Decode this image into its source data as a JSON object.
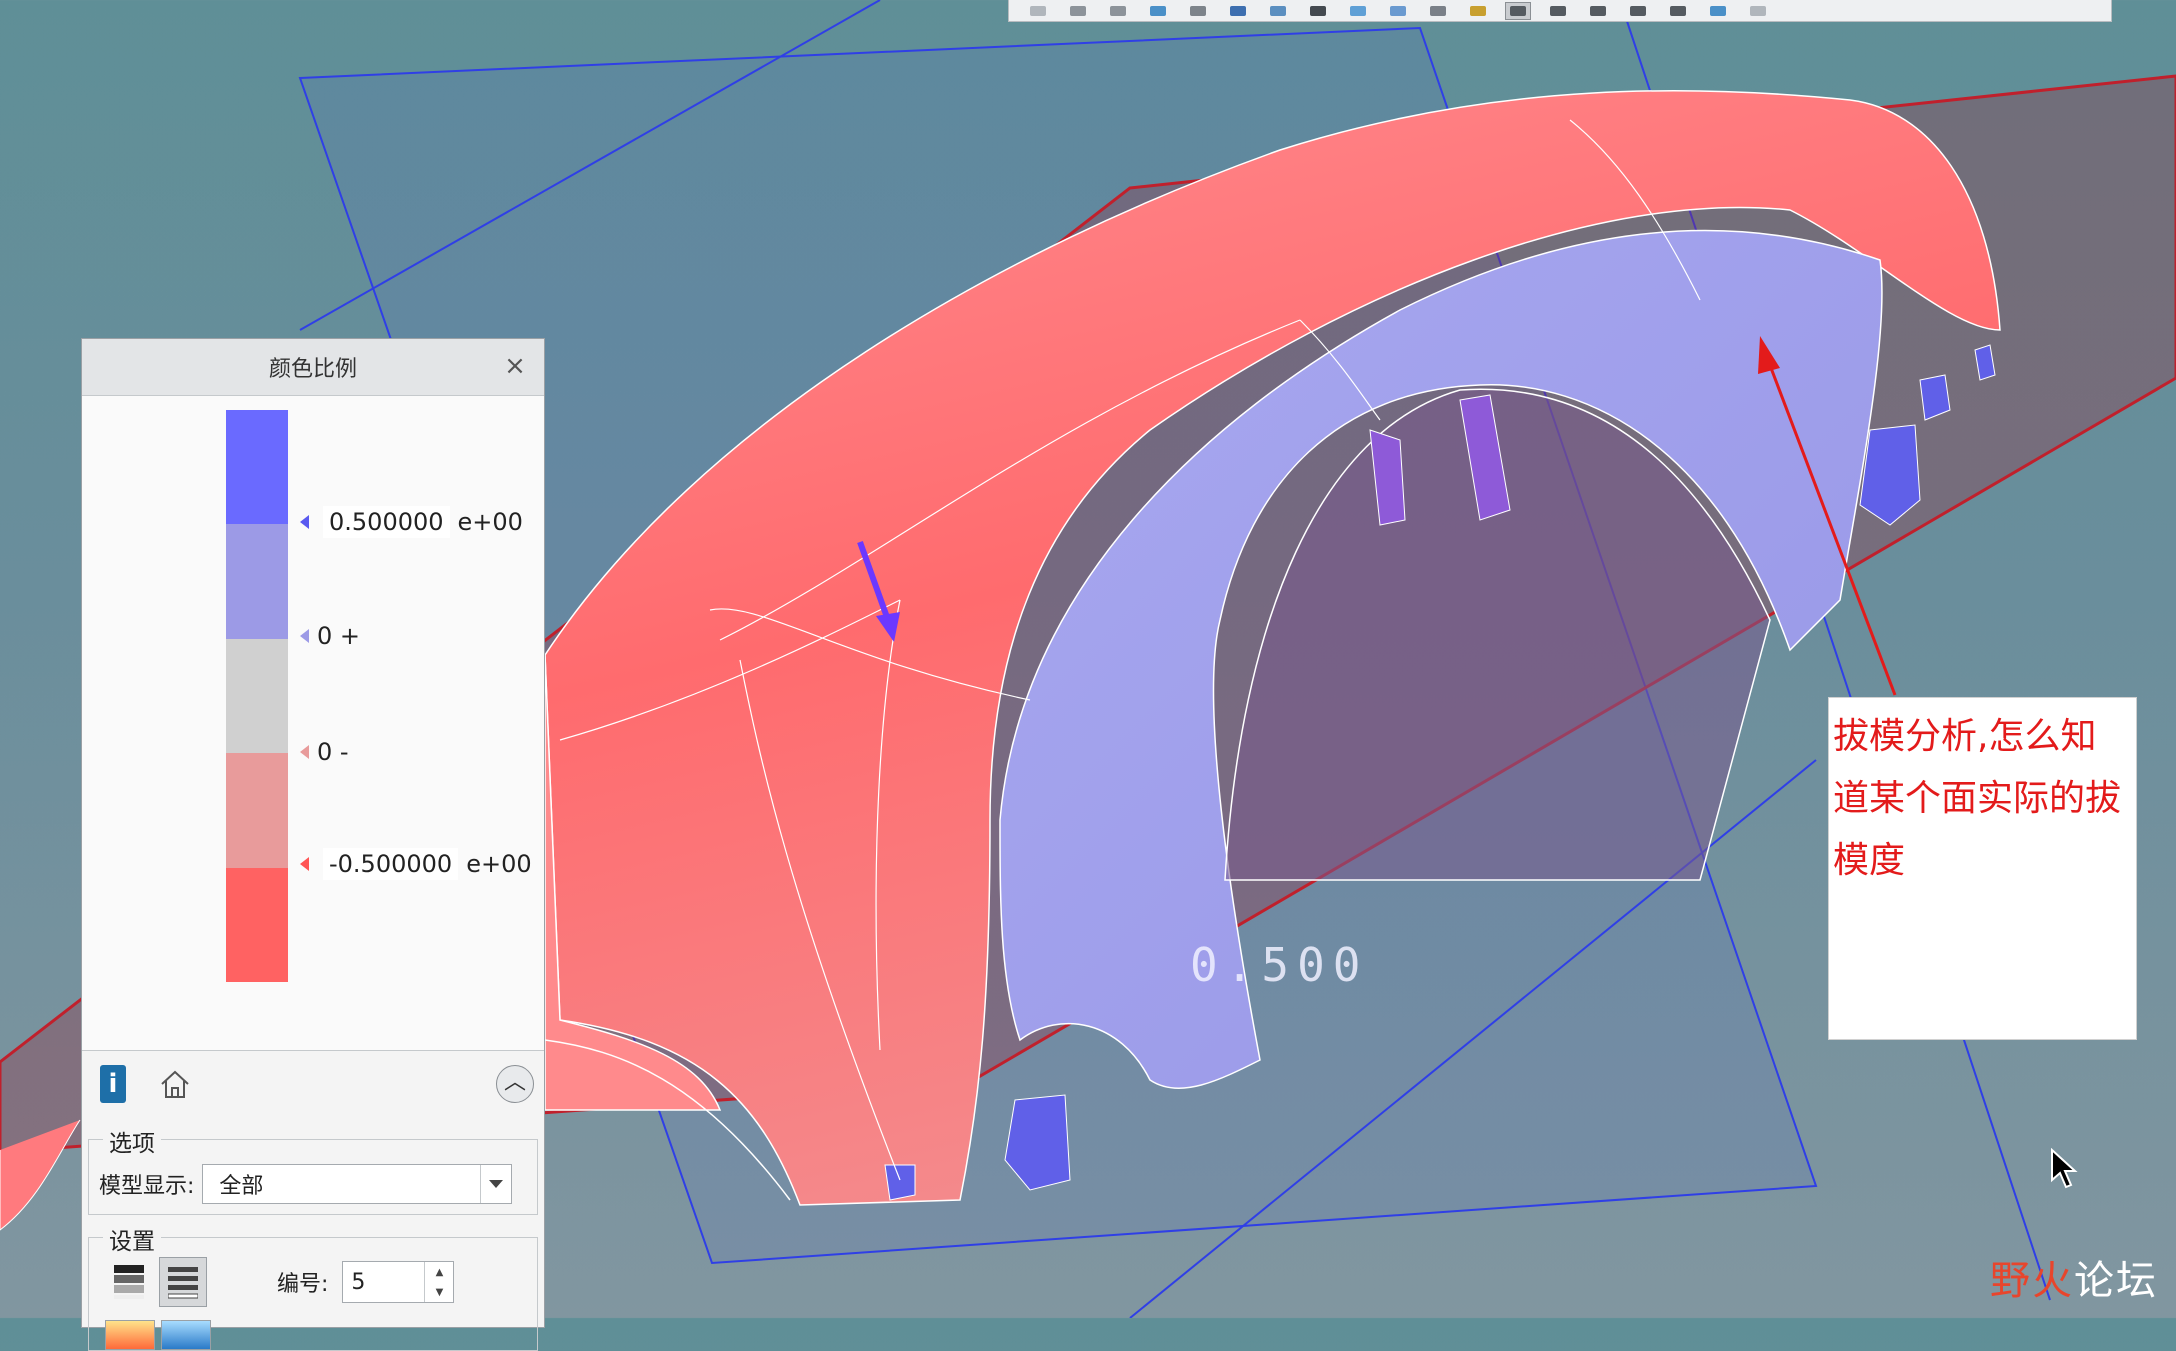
{
  "panel": {
    "title": "颜色比例",
    "scale": {
      "colors": [
        "#6a6aff",
        "#9c9ae6",
        "#d0d0d0",
        "#e89b9b",
        "#ff6262"
      ],
      "labels": [
        {
          "value": "0.500000",
          "exponent": "e+00",
          "marker_color": "#5a5af0"
        },
        {
          "value": "0 +",
          "exponent": "",
          "marker_color": "#9c9ae6"
        },
        {
          "value": "0 -",
          "exponent": "",
          "marker_color": "#e89b9b"
        },
        {
          "value": "-0.500000",
          "exponent": "e+00",
          "marker_color": "#ff5555"
        }
      ]
    },
    "options": {
      "section_title": "选项",
      "model_display_label": "模型显示:",
      "model_display_value": "全部"
    },
    "settings": {
      "section_title": "设置",
      "number_label": "编号:",
      "number_value": "5"
    }
  },
  "annotation": {
    "text": "拔模分析,怎么知道某个面实际的拔模度"
  },
  "dimension_label": "0.500",
  "watermark": {
    "accent": "野火",
    "rest": "论坛"
  },
  "colors": {
    "positive_draft": "#9c9ae6",
    "negative_draft": "#ff6b6b",
    "annotation_red": "#e31b1b",
    "background": "#6a8e9c"
  }
}
